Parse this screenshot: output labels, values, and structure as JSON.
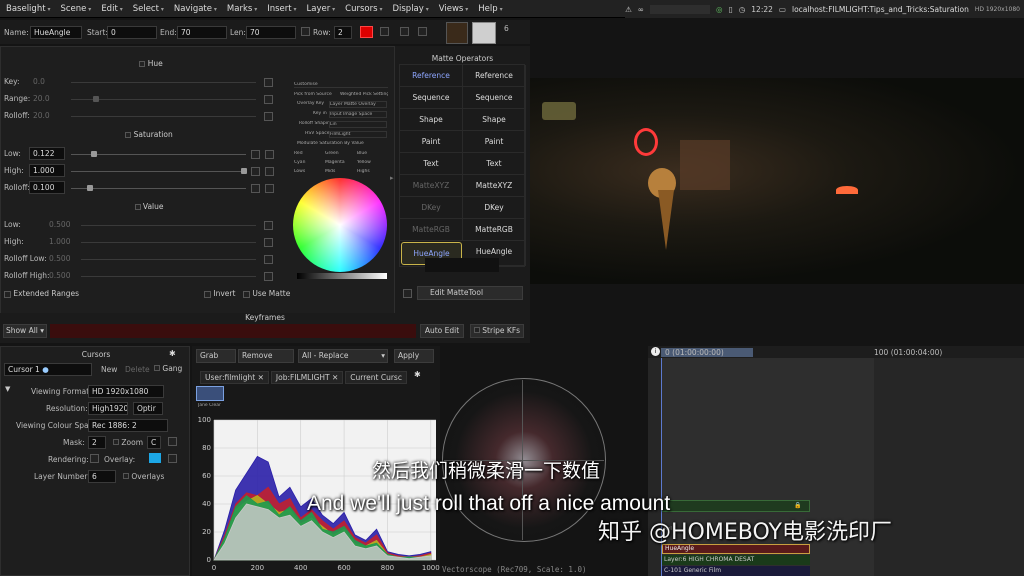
{
  "menu": [
    "Baselight",
    "Scene",
    "Edit",
    "Select",
    "Navigate",
    "Marks",
    "Insert",
    "Layer",
    "Cursors",
    "Display",
    "Views",
    "Help"
  ],
  "tray": {
    "time": "12:22",
    "title": "localhost:FILMLIGHT:Tips_and_Tricks:Saturation",
    "res": "HD 1920x1080"
  },
  "toolbar": {
    "name_label": "Name:",
    "name_value": "HueAngle",
    "start_label": "Start:",
    "start_value": "0",
    "end_label": "End:",
    "end_value": "70",
    "len_label": "Len:",
    "len_value": "70",
    "row_label": "Row:",
    "row_value": "2",
    "badge": "6"
  },
  "hue": {
    "title": "Hue",
    "rows": [
      {
        "label": "Key:",
        "value": "0.0"
      },
      {
        "label": "Range:",
        "value": "20.0"
      },
      {
        "label": "Rolloff:",
        "value": "20.0"
      }
    ]
  },
  "saturation": {
    "title": "Saturation",
    "rows": [
      {
        "label": "Low:",
        "value": "0.122"
      },
      {
        "label": "High:",
        "value": "1.000"
      },
      {
        "label": "Rolloff:",
        "value": "0.100"
      }
    ]
  },
  "value": {
    "title": "Value",
    "rows": [
      {
        "label": "Low:",
        "value": "0.500"
      },
      {
        "label": "High:",
        "value": "1.000"
      },
      {
        "label": "Rolloff Low:",
        "value": "0.500"
      },
      {
        "label": "Rolloff High:",
        "value": "0.500"
      }
    ]
  },
  "bottom_buttons": {
    "extended": "Extended Ranges",
    "invert": "Invert",
    "use_matte": "Use Matte"
  },
  "mini_settings": {
    "r1": "Customise",
    "r2a": "Pick from Source",
    "r2b": "Weighted Pick Settings",
    "r3a": "Overlay Key",
    "r3b": "Layer Matte Overlay",
    "r4a": "Key in",
    "r4b": "Input Image Space",
    "r5a": "Rolloff Shaping",
    "r5b": "Lin",
    "r6a": "HSV Space",
    "r6b": "FilmLight",
    "r7": "Modulate Saturation By Value",
    "grid": [
      "Red",
      "Green",
      "Blue",
      "Cyan",
      "Magenta",
      "Yellow",
      "Lows",
      "Mids",
      "Highs"
    ]
  },
  "matte": {
    "title": "Matte Operators",
    "left": [
      "Reference",
      "Sequence",
      "Shape",
      "Paint",
      "Text",
      "MatteXYZ",
      "DKey",
      "MatteRGB",
      "HueAngle"
    ],
    "right": [
      "Reference",
      "Sequence",
      "Shape",
      "Paint",
      "Text",
      "MatteXYZ",
      "DKey",
      "MatteRGB",
      "HueAngle"
    ],
    "edit": "Edit MatteTool"
  },
  "keyframes": {
    "title": "Keyframes",
    "show_all": "Show All",
    "auto_edit": "Auto Edit",
    "stripe": "Stripe KFs"
  },
  "cursors": {
    "title": "Cursors",
    "cursor": "Cursor 1",
    "new": "New",
    "delete": "Delete",
    "gang": "Gang",
    "viewing_format_label": "Viewing Format:",
    "viewing_format": "HD 1920x1080",
    "resolution_label": "Resolution:",
    "resolution": "High1920",
    "resolution_opt": "Optir",
    "colour_space_label": "Viewing Colour Space:",
    "colour_space": "Rec 1886: 2",
    "mask_label": "Mask:",
    "mask": "2",
    "zoom": "Zoom",
    "zoom_val": "C",
    "rendering_label": "Rendering:",
    "overlay": "Overlay:",
    "layer_number_label": "Layer Number:",
    "layer_number": "6",
    "overlays": "Overlays"
  },
  "scopes": {
    "grab": "Grab",
    "remove": "Remove",
    "replace": "All - Replace",
    "apply": "Apply",
    "tabs": [
      "User:filmlight",
      "Job:FILMLIGHT",
      "Current Cursc"
    ],
    "thumb_label": "Jane Clear",
    "vectorscope": "Vectorscope (Rec709, Scale: 1.0)"
  },
  "timeline": {
    "t0": "0 (01:00:00:00)",
    "t1": "100 (01:00:04:00)",
    "layers": [
      "HueAngle",
      "Layer:6 HIGH CHROMA DESAT",
      "C-101 Generic Film"
    ],
    "stack_small": "Rel"
  },
  "subtitles": {
    "zh": "然后我们稍微柔滑一下数值",
    "en": "And we'll just roll that off a nice amount"
  },
  "watermark": "知乎 @HOMEBOY电影洗印厂",
  "chart_data": {
    "type": "area",
    "title": "",
    "x": [
      0,
      50,
      100,
      150,
      200,
      250,
      300,
      350,
      400,
      450,
      500,
      550,
      600,
      650,
      700,
      750,
      800,
      850,
      900,
      950,
      1000
    ],
    "xlim": [
      0,
      1024
    ],
    "ylim": [
      0,
      100
    ],
    "xticks": [
      0,
      200,
      400,
      600,
      800,
      1000
    ],
    "yticks": [
      0,
      20,
      40,
      60,
      80,
      100
    ],
    "grid": true,
    "series": [
      {
        "color": "#2a1fa8",
        "values": [
          0,
          22,
          50,
          62,
          74,
          70,
          45,
          52,
          38,
          44,
          32,
          26,
          34,
          18,
          14,
          22,
          6,
          4,
          3,
          4,
          6
        ]
      },
      {
        "color": "#c02030",
        "values": [
          0,
          18,
          40,
          48,
          46,
          52,
          40,
          44,
          30,
          36,
          28,
          22,
          28,
          16,
          12,
          18,
          5,
          3,
          2,
          3,
          5
        ]
      },
      {
        "color": "#b8b020",
        "values": [
          0,
          15,
          36,
          42,
          46,
          40,
          34,
          36,
          26,
          30,
          24,
          18,
          22,
          12,
          10,
          14,
          4,
          2,
          2,
          2,
          4
        ]
      },
      {
        "color": "#1e9a50",
        "values": [
          0,
          16,
          38,
          46,
          40,
          42,
          32,
          38,
          28,
          34,
          22,
          20,
          24,
          14,
          10,
          12,
          4,
          2,
          2,
          2,
          3
        ]
      },
      {
        "color": "#c8c8c8",
        "values": [
          0,
          12,
          30,
          40,
          38,
          36,
          30,
          32,
          24,
          28,
          20,
          16,
          20,
          10,
          8,
          10,
          3,
          2,
          1,
          2,
          3
        ]
      }
    ]
  }
}
